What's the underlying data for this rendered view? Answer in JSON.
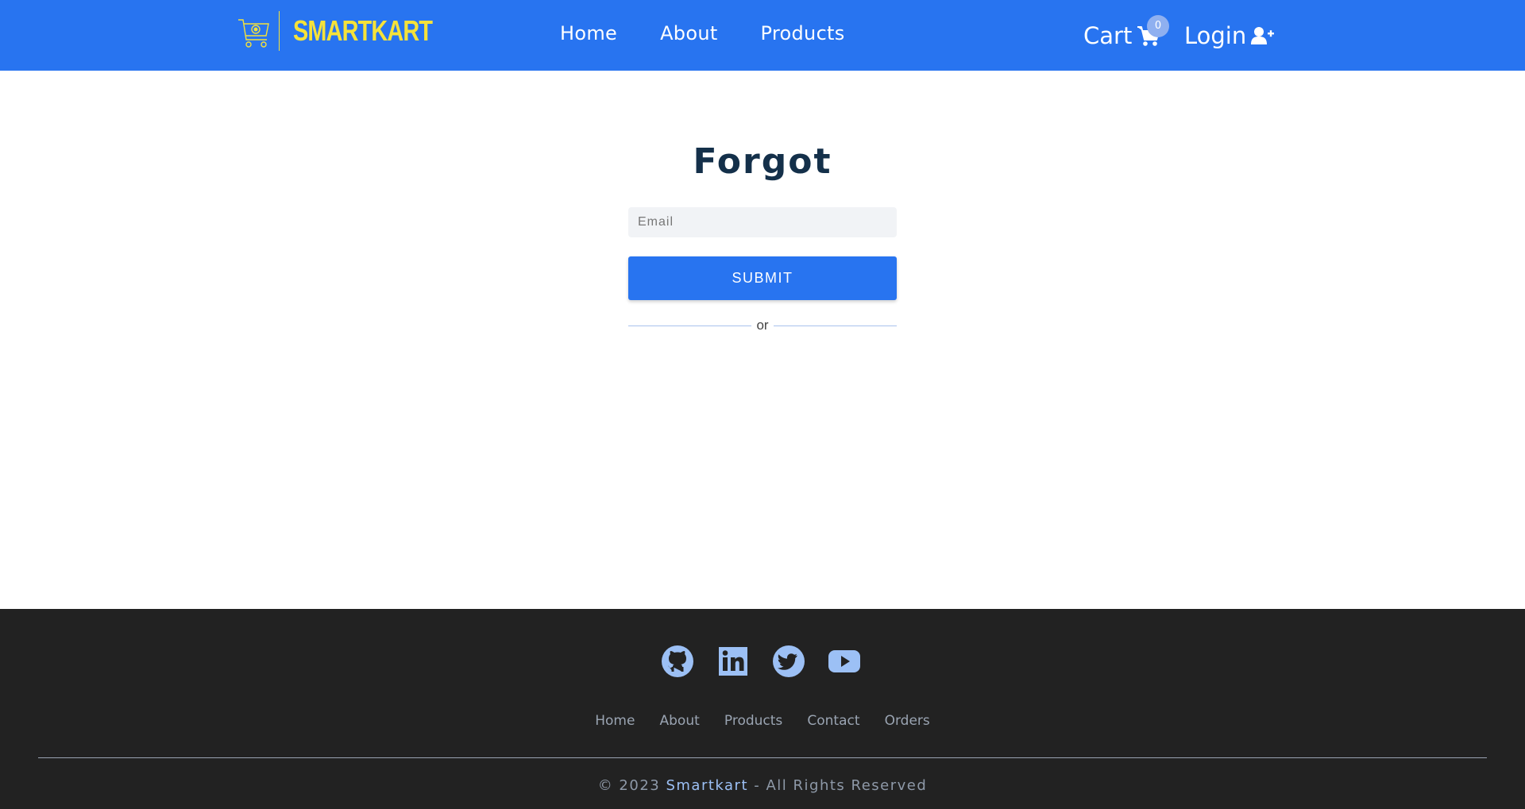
{
  "colors": {
    "header_bg": "#2874f0",
    "logo_yellow": "#f5e23a",
    "title_navy": "#14304a",
    "footer_bg": "#222222",
    "social_icon": "#9cc0f5"
  },
  "header": {
    "logo_icon": "shopping-cart-icon",
    "logo_text": "SMARTKART",
    "nav": [
      "Home",
      "About",
      "Products"
    ],
    "cart": {
      "label": "Cart",
      "count": "0",
      "icon": "cart-icon"
    },
    "login": {
      "label": "Login",
      "icon": "user-plus-icon"
    }
  },
  "form": {
    "title": "Forgot",
    "email_placeholder": "Email",
    "email_value": "",
    "submit_label": "SUBMIT",
    "divider_text": "or"
  },
  "footer": {
    "social": [
      "github-icon",
      "linkedin-icon",
      "twitter-icon",
      "youtube-icon"
    ],
    "nav": [
      "Home",
      "About",
      "Products",
      "Contact",
      "Orders"
    ],
    "copyright_prefix": "© 2023",
    "copyright_brand": "Smartkart",
    "copyright_suffix": "- All Rights Reserved"
  }
}
